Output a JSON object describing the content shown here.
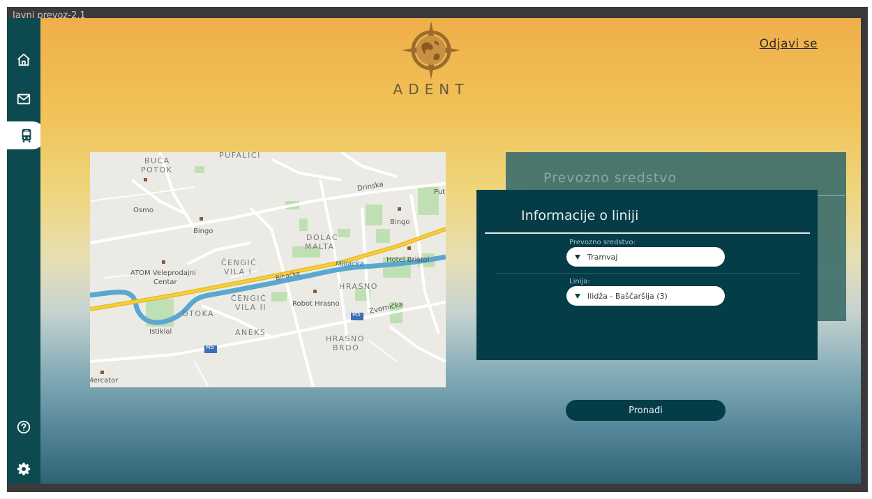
{
  "window": {
    "title": "Javni prevoz-2.1"
  },
  "header": {
    "brand": "ADENT",
    "logout_label": "Odjavi se"
  },
  "sidebar": {
    "items": [
      "home-icon",
      "mail-icon",
      "bus-icon",
      "help-icon",
      "gear-icon"
    ],
    "active": "bus-icon"
  },
  "map": {
    "labels": {
      "puf": "PUFALICI",
      "buca": "BUĆA",
      "potok": "POTOK",
      "osmo": "Osmo",
      "bingo1": "Bingo",
      "drinska": "Drinska",
      "put": "Put",
      "bingo2": "Bingo",
      "dolac": "DOLAC",
      "malta": "MALTA",
      "cengic1": "ČENGIĆ",
      "vila1": "VILA I",
      "atom1": "ATOM Veleprodajni",
      "atom2": "Centar",
      "bihacka": "Bihaćka",
      "miljacka": "Miljacka",
      "hotel": "Hotel Bristol",
      "hrasno": "HRASNO",
      "cengic2": "ČENGIĆ",
      "vila2": "VILA II",
      "robot": "Robot Hrasno",
      "zvornicka": "Zvornička",
      "otoka": "OTOKA",
      "istiklal": "Istiklal",
      "aneks": "ANEKS",
      "hrasno2": "HRASNO",
      "brdo": "BRDO",
      "m5a": "M5",
      "m5b": "M5",
      "mercator": "Mercator"
    }
  },
  "back_card": {
    "title": "Prevozno sredstvo"
  },
  "info_card": {
    "title": "Informacije o liniji",
    "vehicle_label": "Prevozno sredstvo:",
    "vehicle_value": "Tramvaj",
    "line_label": "Linija:",
    "line_value": "Ilidža - Baščaršija (3)"
  },
  "find_button": "Pronađi",
  "colors": {
    "sidebar": "#0d4a4f",
    "card": "#043d48",
    "card_back": "#3e6f6d",
    "road": "#f0c419",
    "river": "#5aa7cf"
  }
}
